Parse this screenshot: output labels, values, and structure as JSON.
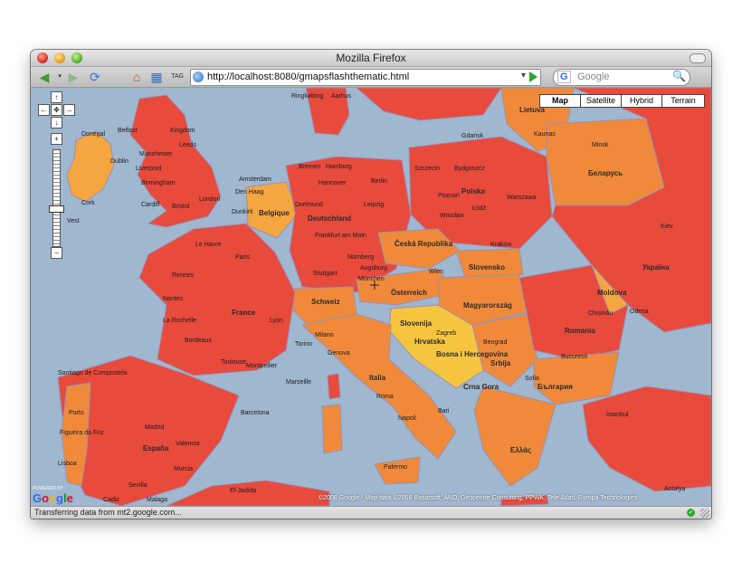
{
  "window": {
    "title": "Mozilla Firefox"
  },
  "toolbar": {
    "url": "http://localhost:8080/gmapsflashthematic.html",
    "search_engine": "G",
    "search_placeholder": "Google",
    "icons": [
      "back-icon",
      "forward-icon",
      "reload-icon",
      "stop-icon",
      "home-icon",
      "bookmark-icon",
      "tag-icon"
    ]
  },
  "map": {
    "types": [
      "Map",
      "Satellite",
      "Hybrid",
      "Terrain"
    ],
    "active_type": "Map",
    "colors": {
      "sea": "#9fb7cf",
      "red": "#e84a3c",
      "orange": "#f08a3a",
      "light_orange": "#f6a640",
      "yellow": "#f6c540",
      "border": "#9a8fb5"
    },
    "countries": [
      "Deutschland",
      "France",
      "España",
      "Italia",
      "Polska",
      "Україна",
      "Беларусь",
      "Romania",
      "Ελλάς",
      "Österreich",
      "Schweiz",
      "Slovensko",
      "Magyarország",
      "Srbija",
      "България",
      "Lietuva",
      "Česká Republika",
      "Bosna i Hercegovina",
      "Crna Gora",
      "Moldova",
      "Slovenija",
      "Hrvatska",
      "Belgique"
    ],
    "cities": [
      "Donegal",
      "Belfast",
      "Dublin",
      "Cork",
      "Liverpool",
      "Manchester",
      "Leeds",
      "Birmingham",
      "Bristol",
      "Cardiff",
      "London",
      "Amsterdam",
      "Den Haag",
      "Dunkirk",
      "Le Havre",
      "Rennes",
      "Nantes",
      "Paris",
      "Lyon",
      "La Rochelle",
      "Bordeaux",
      "Toulouse",
      "Montpellier",
      "Marseille",
      "Santiago de Compostela",
      "Porto",
      "Madrid",
      "Valencia",
      "Barcelona",
      "Sevilla",
      "Murcia",
      "Cadiz",
      "Malaga",
      "Figueira da Foz",
      "Lisboa",
      "Hamburg",
      "Bremen",
      "Hannover",
      "Berlin",
      "Dortmund",
      "Leipzig",
      "Frankfurt am Main",
      "Nürnberg",
      "Stuttgart",
      "München",
      "Augsburg",
      "Wien",
      "Milano",
      "Genova",
      "Torino",
      "Roma",
      "Napoli",
      "Bari",
      "Palermo",
      "Zagreb",
      "Beograd",
      "Sofia",
      "Bucuresti",
      "Kraków",
      "Warszawa",
      "Łódź",
      "Poznań",
      "Wrocław",
      "Szczecin",
      "Bydgoszcz",
      "Gdańsk",
      "Minsk",
      "Kaunas",
      "Kiev",
      "Odesa",
      "Chișinău",
      "İstanbul",
      "Antalya",
      "Ringkøbing",
      "Aarhus",
      "El-Jadida"
    ],
    "regions": [
      "Kingdom",
      "Vest",
      "Crna Gora",
      "Ukraina"
    ]
  },
  "attribution": {
    "powered_by": "POWERED BY",
    "logo": "Google",
    "text": "©2008 Google - Map data ©2008 Basarsoft, AND, Geocentre Consulting, PPWK, Tele Atlas, Europa Technologies"
  },
  "status": {
    "text": "Transferring data from mt2.google.com..."
  }
}
